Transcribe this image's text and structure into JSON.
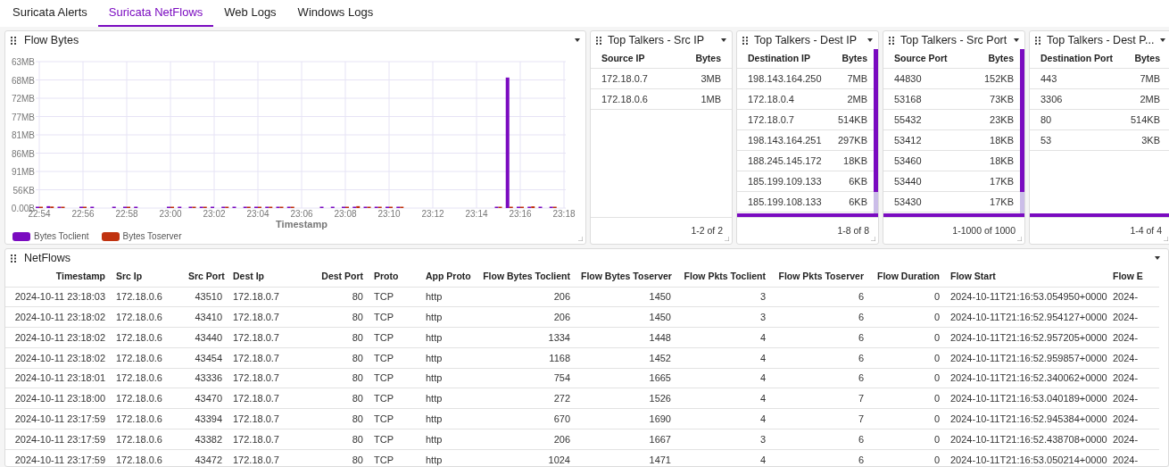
{
  "tabs": [
    {
      "label": "Suricata Alerts",
      "selected": false
    },
    {
      "label": "Suricata NetFlows",
      "selected": true
    },
    {
      "label": "Web Logs",
      "selected": false
    },
    {
      "label": "Windows Logs",
      "selected": false
    }
  ],
  "flow_bytes": {
    "title": "Flow Bytes",
    "x_axis_title": "Timestamp",
    "x_axis_labels": [
      "22:54",
      "22:56",
      "22:58",
      "23:00",
      "23:02",
      "23:04",
      "23:06",
      "23:08",
      "23:10",
      "23:12",
      "23:14",
      "23:16",
      "23:18"
    ],
    "y_axis_labels": [
      "63MB",
      "68MB",
      "72MB",
      "77MB",
      "81MB",
      "86MB",
      "91MB",
      "56KB",
      "0.00B"
    ],
    "legend": [
      {
        "name": "Bytes Toclient",
        "color": "#7a0bc0"
      },
      {
        "name": "Bytes Toserver",
        "color": "#c0320f"
      }
    ]
  },
  "talkers": [
    {
      "title": "Top Talkers - Src IP",
      "columns": [
        "Source IP",
        "Bytes"
      ],
      "rows": [
        [
          "172.18.0.7",
          "3MB"
        ],
        [
          "172.18.0.6",
          "1MB"
        ]
      ],
      "pager": "1-2 of 2"
    },
    {
      "title": "Top Talkers - Dest IP",
      "columns": [
        "Destination IP",
        "Bytes"
      ],
      "rows": [
        [
          "198.143.164.250",
          "7MB"
        ],
        [
          "172.18.0.4",
          "2MB"
        ],
        [
          "172.18.0.7",
          "514KB"
        ],
        [
          "198.143.164.251",
          "297KB"
        ],
        [
          "188.245.145.172",
          "18KB"
        ],
        [
          "185.199.109.133",
          "6KB"
        ],
        [
          "185.199.108.133",
          "6KB"
        ]
      ],
      "pager": "1-8 of 8"
    },
    {
      "title": "Top Talkers - Src Port",
      "columns": [
        "Source Port",
        "Bytes"
      ],
      "rows": [
        [
          "44830",
          "152KB"
        ],
        [
          "53168",
          "73KB"
        ],
        [
          "55432",
          "23KB"
        ],
        [
          "53412",
          "18KB"
        ],
        [
          "53460",
          "18KB"
        ],
        [
          "53440",
          "17KB"
        ],
        [
          "53430",
          "17KB"
        ]
      ],
      "pager": "1-1000 of 1000"
    },
    {
      "title": "Top Talkers - Dest P...",
      "columns": [
        "Destination Port",
        "Bytes"
      ],
      "rows": [
        [
          "443",
          "7MB"
        ],
        [
          "3306",
          "2MB"
        ],
        [
          "80",
          "514KB"
        ],
        [
          "53",
          "3KB"
        ]
      ],
      "pager": "1-4 of 4"
    }
  ],
  "netflows": {
    "title": "NetFlows",
    "columns": [
      "Timestamp",
      "Src Ip",
      "Src Port",
      "Dest Ip",
      "Dest Port",
      "Proto",
      "App Proto",
      "Flow Bytes Toclient",
      "Flow Bytes Toserver",
      "Flow Pkts Toclient",
      "Flow Pkts Toserver",
      "Flow Duration",
      "Flow Start",
      "Flow E"
    ],
    "rows": [
      [
        "2024-10-11 23:18:03",
        "172.18.0.6",
        "43510",
        "172.18.0.7",
        "80",
        "TCP",
        "http",
        "206",
        "1450",
        "3",
        "6",
        "0",
        "2024-10-11T21:16:53.054950+0000",
        "2024-"
      ],
      [
        "2024-10-11 23:18:02",
        "172.18.0.6",
        "43410",
        "172.18.0.7",
        "80",
        "TCP",
        "http",
        "206",
        "1450",
        "3",
        "6",
        "0",
        "2024-10-11T21:16:52.954127+0000",
        "2024-"
      ],
      [
        "2024-10-11 23:18:02",
        "172.18.0.6",
        "43440",
        "172.18.0.7",
        "80",
        "TCP",
        "http",
        "1334",
        "1448",
        "4",
        "6",
        "0",
        "2024-10-11T21:16:52.957205+0000",
        "2024-"
      ],
      [
        "2024-10-11 23:18:02",
        "172.18.0.6",
        "43454",
        "172.18.0.7",
        "80",
        "TCP",
        "http",
        "1168",
        "1452",
        "4",
        "6",
        "0",
        "2024-10-11T21:16:52.959857+0000",
        "2024-"
      ],
      [
        "2024-10-11 23:18:01",
        "172.18.0.6",
        "43336",
        "172.18.0.7",
        "80",
        "TCP",
        "http",
        "754",
        "1665",
        "4",
        "6",
        "0",
        "2024-10-11T21:16:52.340062+0000",
        "2024-"
      ],
      [
        "2024-10-11 23:18:00",
        "172.18.0.6",
        "43470",
        "172.18.0.7",
        "80",
        "TCP",
        "http",
        "272",
        "1526",
        "4",
        "7",
        "0",
        "2024-10-11T21:16:53.040189+0000",
        "2024-"
      ],
      [
        "2024-10-11 23:17:59",
        "172.18.0.6",
        "43394",
        "172.18.0.7",
        "80",
        "TCP",
        "http",
        "670",
        "1690",
        "4",
        "7",
        "0",
        "2024-10-11T21:16:52.945384+0000",
        "2024-"
      ],
      [
        "2024-10-11 23:17:59",
        "172.18.0.6",
        "43382",
        "172.18.0.7",
        "80",
        "TCP",
        "http",
        "206",
        "1667",
        "3",
        "6",
        "0",
        "2024-10-11T21:16:52.438708+0000",
        "2024-"
      ],
      [
        "2024-10-11 23:17:59",
        "172.18.0.6",
        "43472",
        "172.18.0.7",
        "80",
        "TCP",
        "http",
        "1024",
        "1471",
        "4",
        "6",
        "0",
        "2024-10-11T21:16:53.050214+0000",
        "2024-"
      ]
    ]
  }
}
